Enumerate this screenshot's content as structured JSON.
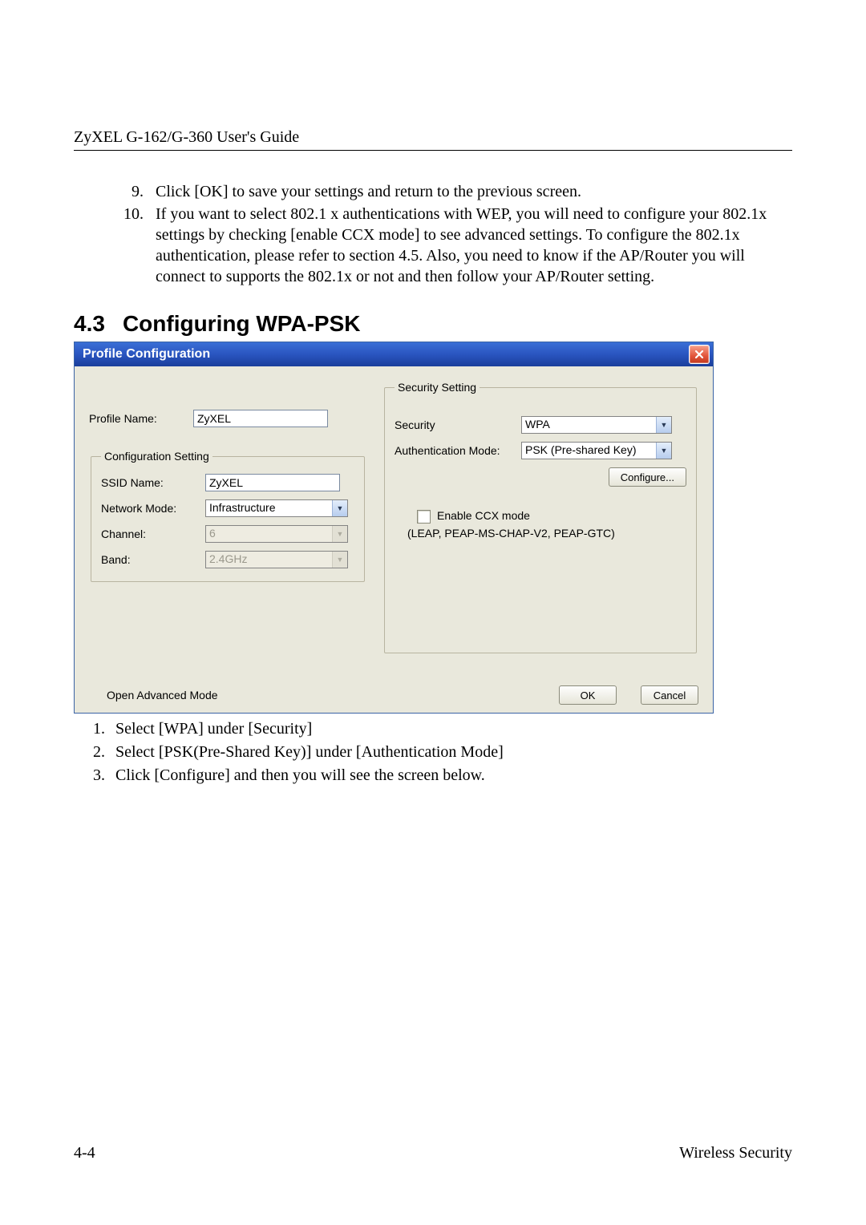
{
  "header": {
    "guide_title": "ZyXEL G-162/G-360 User's Guide"
  },
  "steps_top": [
    "Click [OK] to save your settings and return to the previous screen.",
    "If you want to select 802.1 x authentications with WEP, you will need to configure your 802.1x settings by checking [enable CCX mode] to see advanced settings.  To configure the 802.1x authentication, please refer to section 4.5.  Also, you need to know if the AP/Router you will connect to supports the 802.1x or not and then follow your AP/Router setting."
  ],
  "section": {
    "number": "4.3",
    "title": "Configuring WPA-PSK"
  },
  "dialog": {
    "title": "Profile Configuration",
    "profile_name_label": "Profile Name:",
    "profile_name_value": "ZyXEL",
    "config_legend": "Configuration Setting",
    "ssid_label": "SSID Name:",
    "ssid_value": "ZyXEL",
    "network_mode_label": "Network Mode:",
    "network_mode_value": "Infrastructure",
    "channel_label": "Channel:",
    "channel_value": "6",
    "band_label": "Band:",
    "band_value": "2.4GHz",
    "security_legend": "Security Setting",
    "security_label": "Security",
    "security_value": "WPA",
    "auth_mode_label": "Authentication Mode:",
    "auth_mode_value": "PSK (Pre-shared Key)",
    "configure_button": "Configure...",
    "ccx_label": "Enable CCX mode",
    "ccx_hint": "(LEAP, PEAP-MS-CHAP-V2, PEAP-GTC)",
    "advanced_link": "Open Advanced Mode",
    "ok_button": "OK",
    "cancel_button": "Cancel"
  },
  "steps_below": [
    "Select [WPA] under [Security]",
    "Select [PSK(Pre-Shared Key)] under [Authentication Mode]",
    "Click [Configure] and then you will see the screen below."
  ],
  "footer": {
    "page": "4-4",
    "section": "Wireless Security"
  }
}
